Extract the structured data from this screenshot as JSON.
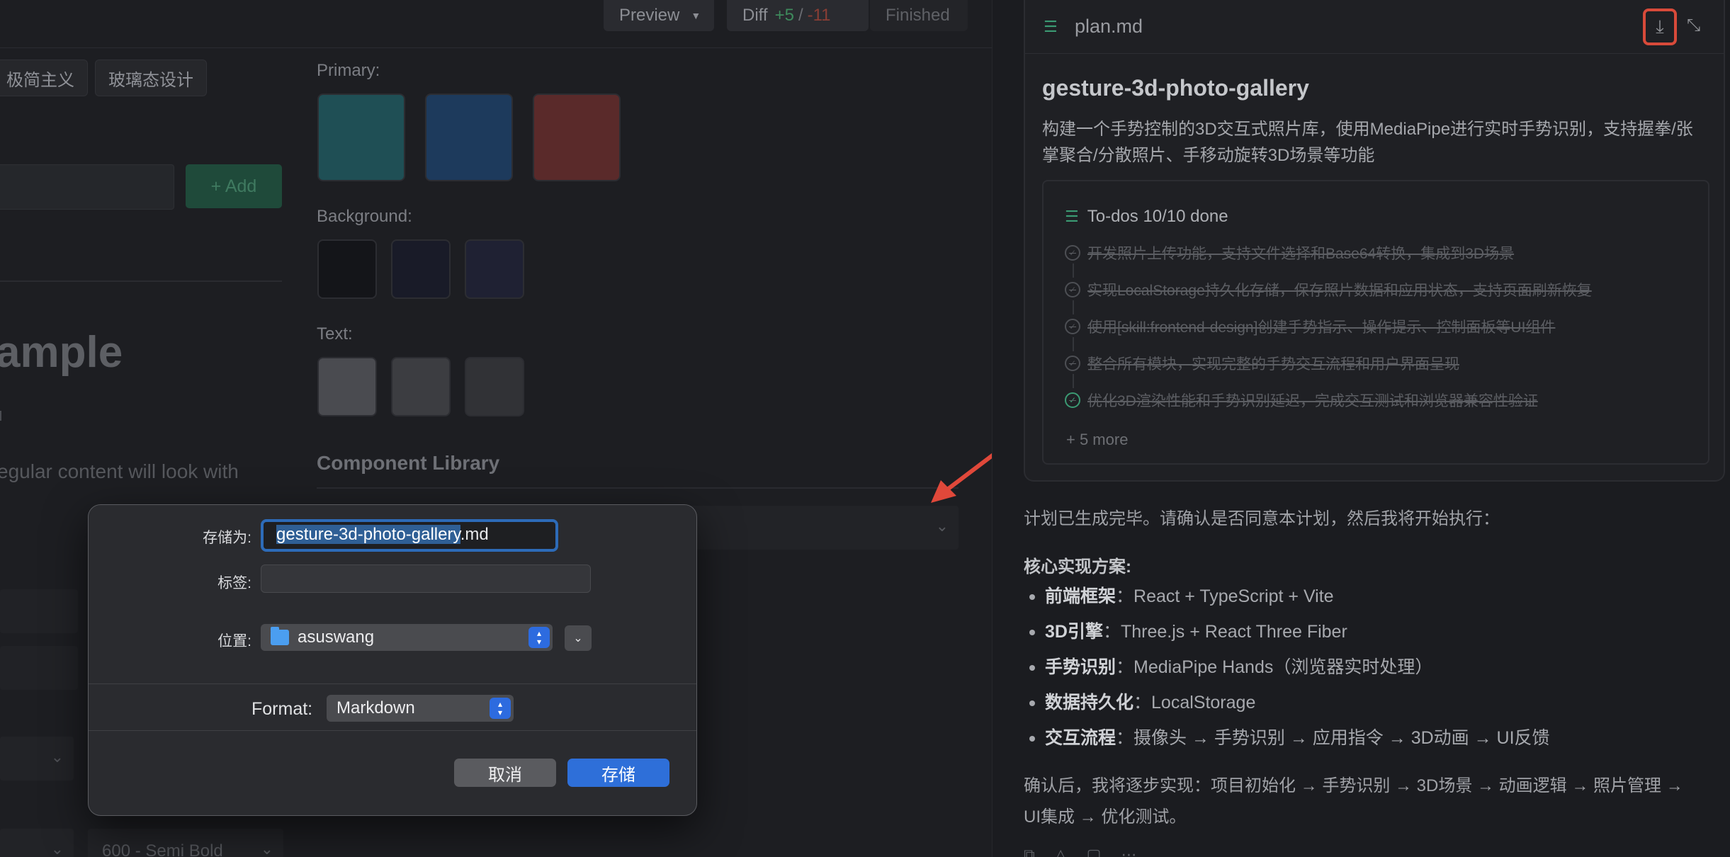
{
  "toolbar": {
    "preview_label": "Preview",
    "diff_label": "Diff",
    "diff_added": "+5",
    "diff_sep": "/",
    "diff_removed": "-11",
    "finished_label": "Finished"
  },
  "editor": {
    "tags": [
      "极简主义",
      "玻璃态设计"
    ],
    "add_button": "+ Add",
    "example_heading": "ample",
    "example_body": "egular content will look with",
    "primary_label": "Primary:",
    "background_label": "Background:",
    "text_label": "Text:",
    "component_library_label": "Component Library",
    "font_weight_value": "600 - Semi Bold",
    "colors": {
      "primary": [
        "#1f4f55",
        "#1d3a5c",
        "#5a2a2a"
      ],
      "background": [
        "#141519",
        "#191b28",
        "#1f2133"
      ],
      "text": [
        "#4a4b50",
        "#3c3d41",
        "#313236"
      ]
    }
  },
  "dialog": {
    "save_as_label": "存储为:",
    "filename_selected": "gesture-3d-photo-gallery",
    "filename_ext": ".md",
    "tags_label": "标签:",
    "tags_value": "",
    "where_label": "位置:",
    "where_value": "asuswang",
    "format_label": "Format:",
    "format_value": "Markdown",
    "cancel_label": "取消",
    "save_label": "存储"
  },
  "plan": {
    "filename": "plan.md",
    "title": "gesture-3d-photo-gallery",
    "description": "构建一个手势控制的3D交互式照片库，使用MediaPipe进行实时手势识别，支持握拳/张掌聚合/分散照片、手移动旋转3D场景等功能",
    "todo_header": "To-dos 10/10 done",
    "todos": [
      "开发照片上传功能，支持文件选择和Base64转换，集成到3D场景",
      "实现LocalStorage持久化存储，保存照片数据和应用状态，支持页面刷新恢复",
      "使用[skill:frontend-design]创建手势指示、操作提示、控制面板等UI组件",
      "整合所有模块，实现完整的手势交互流程和用户界面呈现",
      "优化3D渲染性能和手势识别延迟，完成交互测试和浏览器兼容性验证"
    ],
    "more_label": "+ 5 more"
  },
  "message": {
    "confirm_text": "计划已生成完毕。请确认是否同意本计划，然后我将开始执行：",
    "core_heading": "核心实现方案:",
    "bullets": [
      {
        "key": "前端框架",
        "value": "：React + TypeScript + Vite"
      },
      {
        "key": "3D引擎",
        "value": "：Three.js + React Three Fiber"
      },
      {
        "key": "手势识别",
        "value": "：MediaPipe Hands（浏览器实时处理）"
      },
      {
        "key": "数据持久化",
        "value": "：LocalStorage"
      },
      {
        "key": "交互流程",
        "value": "：摄像头 → 手势识别 → 应用指令 → 3D动画 → UI反馈"
      }
    ],
    "after_text": "确认后，我将逐步实现：项目初始化 → 手势识别 → 3D场景 → 动画逻辑 → 照片管理 → UI集成 → 优化测试。"
  },
  "accent": {
    "red_highlight": "#d84a3a",
    "save_blue": "#2e6fd9",
    "check_green": "#3b9a73"
  },
  "icons": {
    "download": "download-icon",
    "collapse": "collapse-icon",
    "list": "list-icon",
    "folder": "folder-icon",
    "arrow": "red-arrow-annotation"
  }
}
